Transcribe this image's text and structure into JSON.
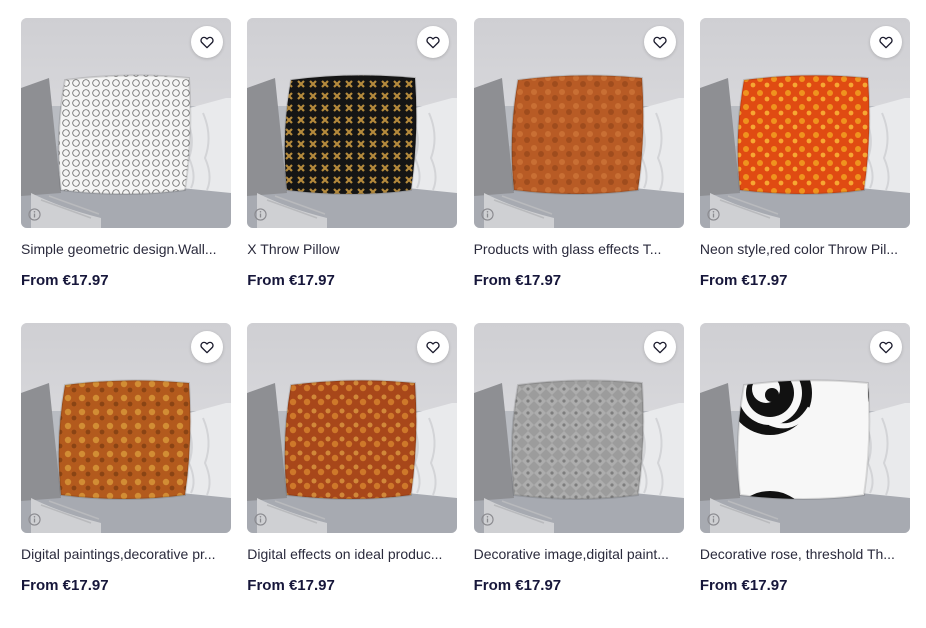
{
  "products": [
    {
      "title": "Simple geometric design.Wall...",
      "price": "From €17.97",
      "pillow": "geo-white"
    },
    {
      "title": "X Throw Pillow",
      "price": "From €17.97",
      "pillow": "x-black"
    },
    {
      "title": "Products with glass effects T...",
      "price": "From €17.97",
      "pillow": "glass-orange"
    },
    {
      "title": "Neon style,red color Throw Pil...",
      "price": "From €17.97",
      "pillow": "neon-red"
    },
    {
      "title": "Digital paintings,decorative pr...",
      "price": "From €17.97",
      "pillow": "digital-orange"
    },
    {
      "title": "Digital effects on ideal produc...",
      "price": "From €17.97",
      "pillow": "effects-orange"
    },
    {
      "title": "Decorative image,digital paint...",
      "price": "From €17.97",
      "pillow": "grey-texture"
    },
    {
      "title": "Decorative rose, threshold Th...",
      "price": "From €17.97",
      "pillow": "rose-white"
    }
  ],
  "icons": {
    "favorite": "heart-outline-icon",
    "info": "info-icon"
  },
  "colors": {
    "price": "#16163a",
    "title": "#2a2a3c",
    "sofa": "#a9acb3",
    "wall": "#d8d8db"
  }
}
